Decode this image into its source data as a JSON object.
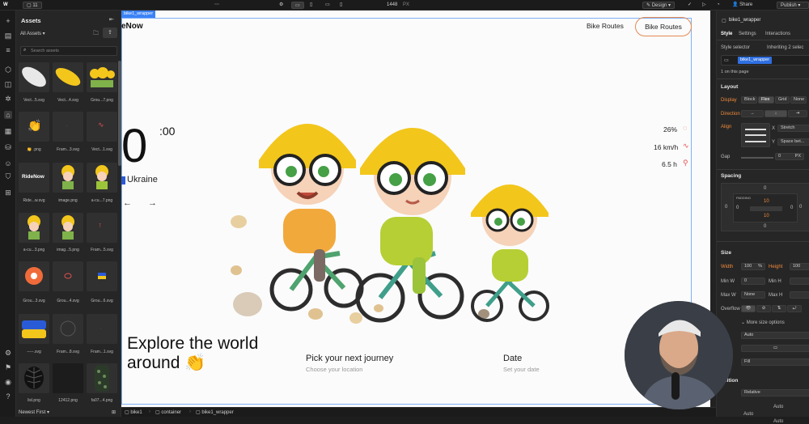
{
  "topbar": {
    "page_tab": "11",
    "width_value": "1448",
    "width_unit": "PX",
    "design_mode": "Design",
    "share_label": "Share",
    "publish_label": "Publish"
  },
  "assets_panel": {
    "title": "Assets",
    "filter": "All Assets",
    "search_placeholder": "Search assets",
    "sort": "Newest First",
    "items": [
      {
        "name": "Vect...5.svg",
        "icon": "white-leaf-shape"
      },
      {
        "name": "Vect...4.svg",
        "icon": "yellow-leaf-shape"
      },
      {
        "name": "Grou...7.png",
        "icon": "kids-group-thumbnail"
      },
      {
        "name": ".png",
        "icon": "clapping-hands-emoji"
      },
      {
        "name": "Fram...3.svg",
        "icon": "blank-frame"
      },
      {
        "name": "Vect...1.svg",
        "icon": "red-squiggle"
      },
      {
        "name": "Ride...w.svg",
        "icon": "ridenow-logo"
      },
      {
        "name": "image.png",
        "icon": "kid-thumbnail"
      },
      {
        "name": "a-cu...7.png",
        "icon": "kid-thumbnail"
      },
      {
        "name": "a-cu...3.png",
        "icon": "kid-thumbnail"
      },
      {
        "name": "imag...5.png",
        "icon": "kid-thumbnail"
      },
      {
        "name": "Fram...5.svg",
        "icon": "temperature-icon"
      },
      {
        "name": "Grou...3.svg",
        "icon": "orange-circle"
      },
      {
        "name": "Grou...4.svg",
        "icon": "red-oval-outline"
      },
      {
        "name": "Grou...6.svg",
        "icon": "ukraine-flag-small"
      },
      {
        "name": "-----.svg",
        "icon": "ukraine-flag-large"
      },
      {
        "name": "Fram...8.svg",
        "icon": "circle-outline"
      },
      {
        "name": "Fram...1.svg",
        "icon": "blank-frame"
      },
      {
        "name": "lisl.png",
        "icon": "dark-leaf"
      },
      {
        "name": "12412.png",
        "icon": "dark-texture"
      },
      {
        "name": "fa07...4.png",
        "icon": "green-texture"
      }
    ],
    "ridenow_text": "RideNow"
  },
  "canvas": {
    "selection_label": "bike1_wrapper",
    "logo_partial": "eNow",
    "nav_link": "Bike Routes",
    "nav_button": "Bike Routes",
    "big_number": "0",
    "big_number_sup": ":00",
    "country": "Ukraine",
    "arrow_left": "←",
    "arrow_right": "→",
    "stats": [
      {
        "value": "26%",
        "icon": "drop-icon"
      },
      {
        "value": "16 km/h",
        "icon": "pulse-icon"
      },
      {
        "value": "6.5 h",
        "icon": "route-icon"
      }
    ],
    "headline_line1": "Explore the world",
    "headline_line2": "around",
    "headline_emoji": "👏",
    "journey_title": "Pick your next journey",
    "journey_sub": "Choose your location",
    "date_title": "Date",
    "date_sub": "Set your date"
  },
  "right_panel": {
    "element_name": "bike1_wrapper",
    "tabs": [
      "Style",
      "Settings",
      "Interactions"
    ],
    "style_selector_label": "Style selector",
    "inheriting": "Inheriting 2 selec",
    "class_chip": "bike1_wrapper",
    "on_page": "1 on this page",
    "layout_title": "Layout",
    "display_label": "Display",
    "display_options": [
      "Block",
      "Flex",
      "Grid",
      "None"
    ],
    "direction_label": "Direction",
    "align_label": "Align",
    "align_x": "Stretch",
    "align_y": "Space bet...",
    "gap_label": "Gap",
    "gap_value": "0",
    "gap_unit": "PX",
    "spacing_title": "Spacing",
    "margin_values": [
      "0",
      "0",
      "0",
      "0"
    ],
    "padding_label": "PADDING",
    "padding_values": [
      "10",
      "0",
      "10",
      "0"
    ],
    "size_title": "Size",
    "width_label": "Width",
    "width_value": "100",
    "width_unit": "%",
    "height_label": "Height",
    "height_value": "100",
    "minw_label": "Min W",
    "minw_value": "0",
    "minh_label": "Min H",
    "maxw_label": "Max W",
    "maxw_value": "None",
    "maxh_label": "Max H",
    "overflow_label": "Overflow",
    "more_size": "More size options",
    "ratio_value": "Auto",
    "fit_value": "Fill",
    "position_title": "osition",
    "position_value": "Relative",
    "auto_values": [
      "Auto",
      "Auto",
      "Auto"
    ]
  },
  "bottombar": {
    "crumbs": [
      "bike1",
      "container",
      "bike1_wrapper"
    ]
  },
  "colors": {
    "accent_orange": "#f08a3c",
    "selection_blue": "#3b82f6",
    "helmet_yellow": "#f3c61c",
    "bike_green": "#4fa36e"
  }
}
